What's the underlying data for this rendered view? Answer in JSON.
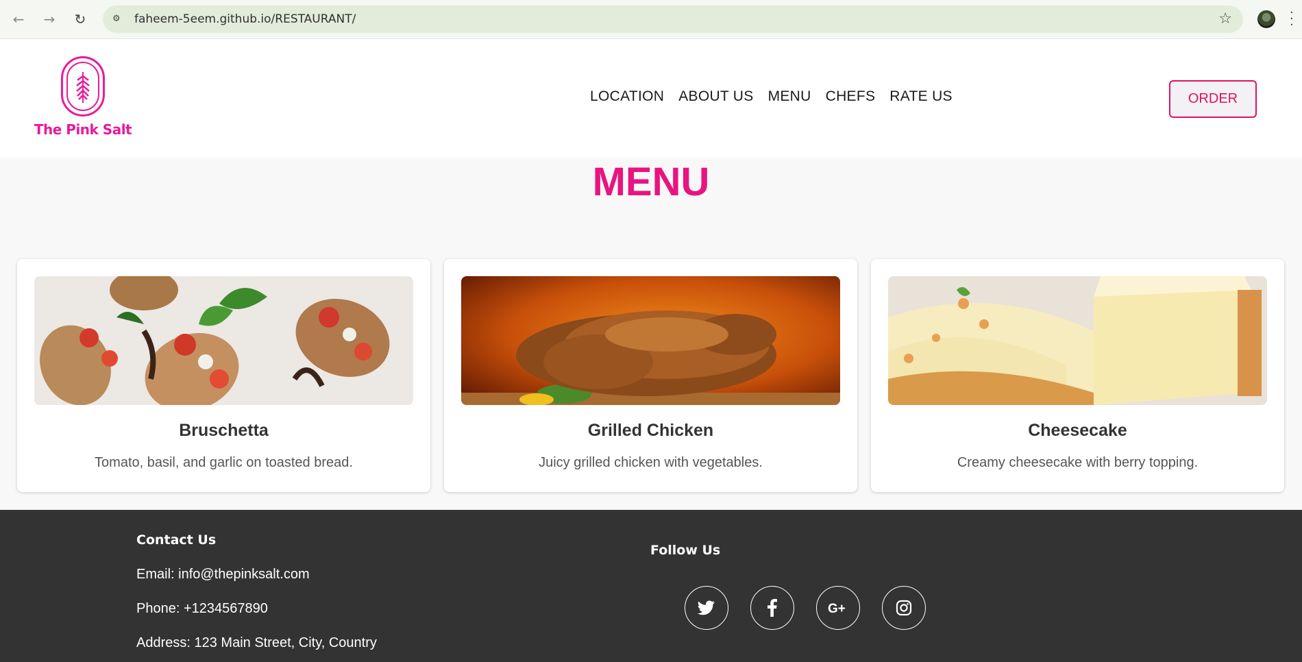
{
  "browser": {
    "url": "faheem-5eem.github.io/RESTAURANT/"
  },
  "header": {
    "logo_text": "The Pink Salt",
    "nav": [
      "LOCATION",
      "ABOUT US",
      "MENU",
      "CHEFS",
      "RATE US"
    ],
    "order_label": "ORDER"
  },
  "menu": {
    "title": "MENU",
    "items": [
      {
        "name": "Bruschetta",
        "description": "Tomato, basil, and garlic on toasted bread."
      },
      {
        "name": "Grilled Chicken",
        "description": "Juicy grilled chicken with vegetables."
      },
      {
        "name": "Cheesecake",
        "description": "Creamy cheesecake with berry topping."
      }
    ]
  },
  "footer": {
    "contact_heading": "Contact Us",
    "email": "Email: info@thepinksalt.com",
    "phone": "Phone: +1234567890",
    "address": "Address: 123 Main Street, City, Country",
    "follow_heading": "Follow Us",
    "social": [
      "twitter-icon",
      "facebook-icon",
      "google-plus-icon",
      "instagram-icon"
    ]
  },
  "colors": {
    "brand_pink": "#e81a9b",
    "title_pink": "#e81480",
    "order_pink": "#e0115f",
    "footer_bg": "#333333"
  }
}
